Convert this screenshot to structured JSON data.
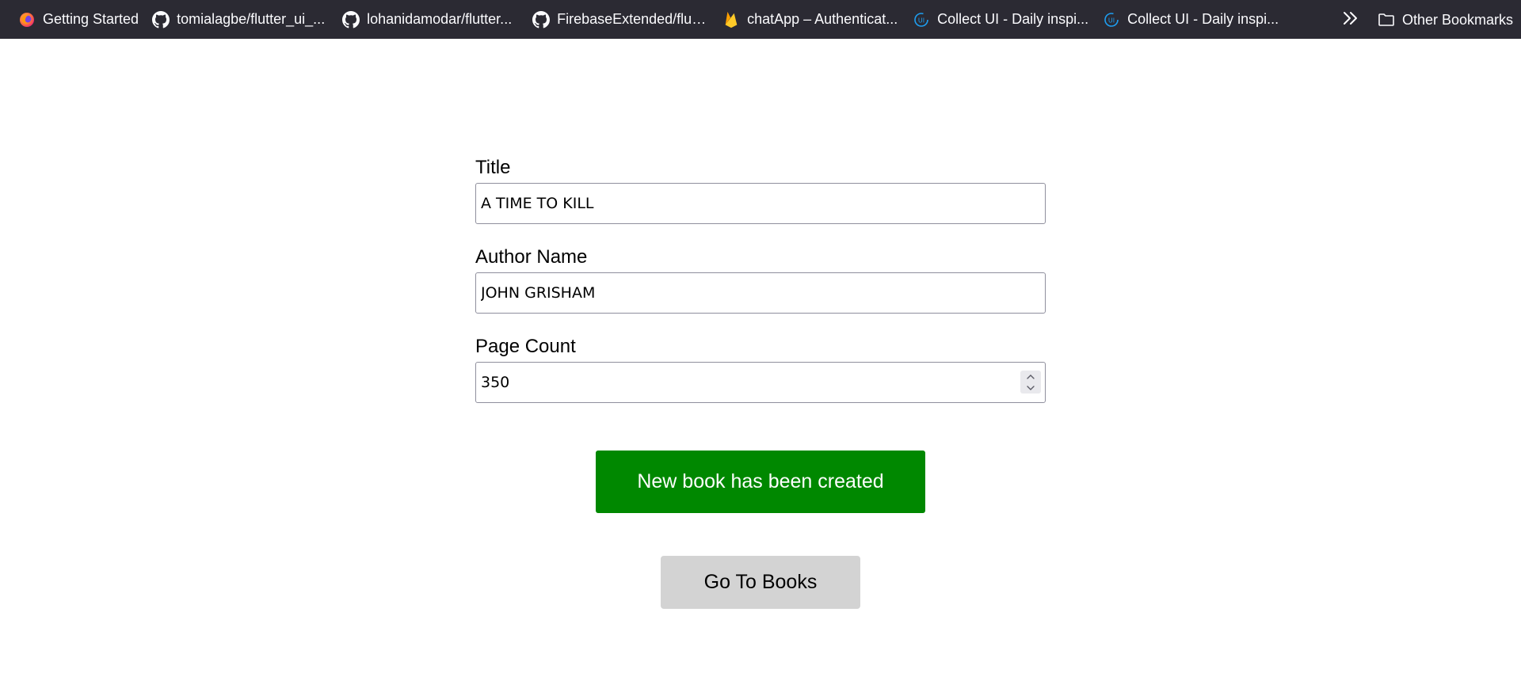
{
  "bookmarks_bar": {
    "items": [
      {
        "label": "Getting Started",
        "icon": "firefox-icon"
      },
      {
        "label": "tomialagbe/flutter_ui_...",
        "icon": "github-icon"
      },
      {
        "label": "lohanidamodar/flutter...",
        "icon": "github-icon"
      },
      {
        "label": "FirebaseExtended/flutt...",
        "icon": "github-icon"
      },
      {
        "label": "chatApp – Authenticat...",
        "icon": "firebase-icon"
      },
      {
        "label": "Collect UI - Daily inspi...",
        "icon": "collectui-icon"
      },
      {
        "label": "Collect UI - Daily inspi...",
        "icon": "collectui-icon"
      }
    ],
    "overflow_icon": "double-chevron-right-icon",
    "other_bookmarks": {
      "label": "Other Bookmarks",
      "icon": "folder-icon"
    }
  },
  "form": {
    "title": {
      "label": "Title",
      "value": "A TIME TO KILL"
    },
    "author": {
      "label": "Author Name",
      "value": "JOHN GRISHAM"
    },
    "page_count": {
      "label": "Page Count",
      "value": "350"
    }
  },
  "actions": {
    "status_button": "New book has been created",
    "go_to_books": "Go To Books"
  },
  "colors": {
    "bookmarks_bar_bg": "#2b2a33",
    "success_green": "#008800",
    "secondary_button": "#d3d3d3"
  }
}
